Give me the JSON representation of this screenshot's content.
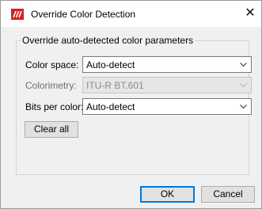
{
  "window": {
    "title": "Override Color Detection",
    "close_glyph": "✕",
    "icon": "app-logo-icon",
    "icon_color": "#d5211f"
  },
  "group": {
    "legend": "Override auto-detected color parameters",
    "fields": [
      {
        "label": "Color space:",
        "value": "Auto-detect",
        "enabled": true
      },
      {
        "label": "Colorimetry:",
        "value": "ITU-R BT.601",
        "enabled": false
      },
      {
        "label": "Bits per color:",
        "value": "Auto-detect",
        "enabled": true
      }
    ],
    "clear_all_label": "Clear all"
  },
  "buttons": {
    "ok_label": "OK",
    "cancel_label": "Cancel"
  },
  "colors": {
    "focus_border": "#0078d7",
    "dialog_bg": "#f0f0f0"
  }
}
